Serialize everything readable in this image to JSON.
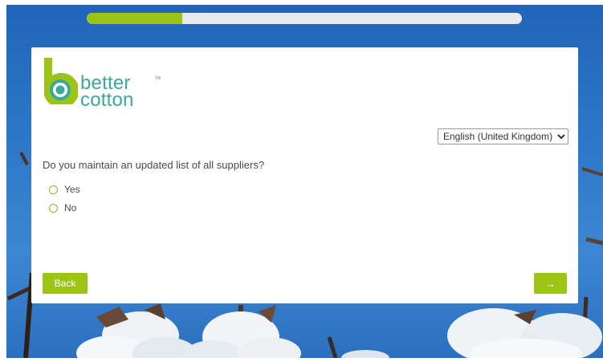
{
  "progress": {
    "fraction": 0.22
  },
  "brand": {
    "line1": "better",
    "line2": "cotton",
    "tm": "TM",
    "color": "#3aa99a"
  },
  "language": {
    "selected": "English (United Kingdom)"
  },
  "question": {
    "text": "Do you maintain an updated list of all suppliers?"
  },
  "options": [
    {
      "label": "Yes"
    },
    {
      "label": "No"
    }
  ],
  "buttons": {
    "back": "Back",
    "next": "→"
  },
  "colors": {
    "accent": "#9cc416",
    "sky": "#2e78c8",
    "card": "#ffffff"
  }
}
